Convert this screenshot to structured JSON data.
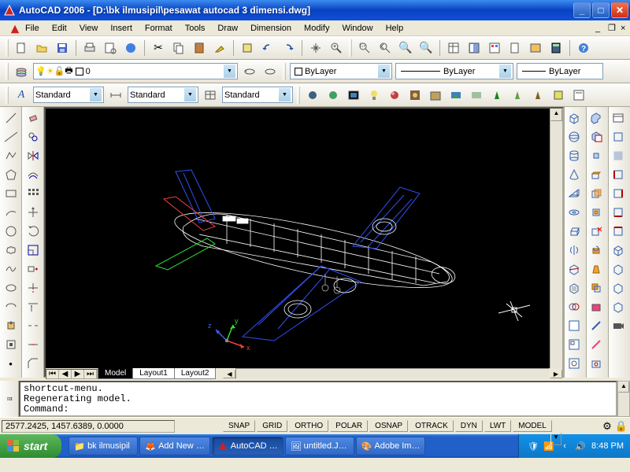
{
  "titlebar": {
    "title": "AutoCAD 2006 - [D:\\bk ilmusipil\\pesawat autocad 3 dimensi.dwg]"
  },
  "menu": [
    "File",
    "Edit",
    "View",
    "Insert",
    "Format",
    "Tools",
    "Draw",
    "Dimension",
    "Modify",
    "Window",
    "Help"
  ],
  "layer_combo": {
    "value": "0"
  },
  "color_combo": {
    "value": "ByLayer"
  },
  "linetype_combo": {
    "value": "ByLayer"
  },
  "lineweight_combo": {
    "value": "ByLayer"
  },
  "textstyle1": "Standard",
  "textstyle2": "Standard",
  "textstyle3": "Standard",
  "tabs": {
    "active": "Model",
    "items": [
      "Model",
      "Layout1",
      "Layout2"
    ]
  },
  "command": {
    "line1": "shortcut-menu.",
    "line2": "Regenerating model.",
    "line3": "Command:"
  },
  "status": {
    "coords": "2577.2425, 1457.6389, 0.0000",
    "modes": [
      "SNAP",
      "GRID",
      "ORTHO",
      "POLAR",
      "OSNAP",
      "OTRACK",
      "DYN",
      "LWT",
      "MODEL"
    ]
  },
  "ucs": {
    "x": "x",
    "y": "y",
    "z": "z"
  },
  "taskbar": {
    "start": "start",
    "items": [
      {
        "label": "bk ilmusipil"
      },
      {
        "label": "Add New …"
      },
      {
        "label": "AutoCAD …",
        "active": true
      },
      {
        "label": "untitled.J…"
      },
      {
        "label": "Adobe Im…"
      }
    ],
    "time": "8:48 PM"
  }
}
